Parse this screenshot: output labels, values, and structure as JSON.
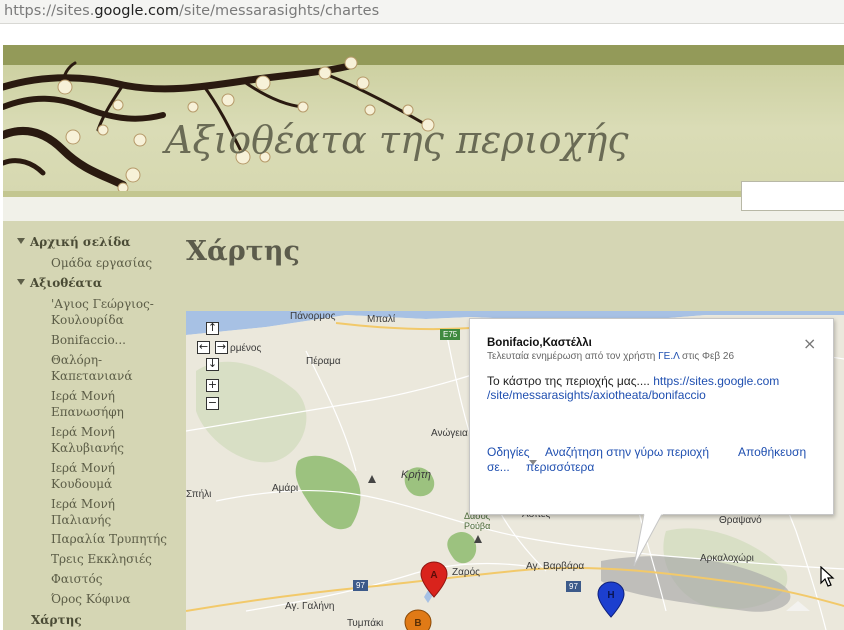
{
  "browser": {
    "url_prefix": "https://sites.",
    "url_domain": "google.com",
    "url_path": "/site/messarasights/chartes"
  },
  "site": {
    "title": "Αξιοθέατα της περιοχής"
  },
  "sidebar": {
    "home": "Αρχική σελίδα",
    "work_group": "Ομάδα εργασίας",
    "sights": "Αξιοθέατα",
    "items": [
      {
        "line1": "'Αγιος Γεώργιος-",
        "line2": "Κουλουρίδα"
      },
      {
        "line1": "Bonifaccio...",
        "line2": ""
      },
      {
        "line1": "Θαλόρη-",
        "line2": "Καπετανιανά"
      },
      {
        "line1": "Ιερά Μονή",
        "line2": "Επανωσήφη"
      },
      {
        "line1": "Ιερά Μονή",
        "line2": "Καλυβιανής"
      },
      {
        "line1": "Ιερά Μονή",
        "line2": "Κουδουμά"
      },
      {
        "line1": "Ιερά Μονή",
        "line2": "Παλιανής"
      },
      {
        "line1": "Παραλία Τρυπητής",
        "line2": ""
      },
      {
        "line1": "Τρεις Εκκλησιές",
        "line2": ""
      },
      {
        "line1": "Φαιστός",
        "line2": ""
      },
      {
        "line1": "Όρος Κόφινα",
        "line2": ""
      }
    ],
    "map": "Χάρτης"
  },
  "page": {
    "title": "Χάρτης"
  },
  "map": {
    "controls": {
      "up": "↑",
      "left": "←",
      "right": "→",
      "down": "↓",
      "zoom_in": "+",
      "zoom_out": "−"
    },
    "labels": {
      "panormos": "Πάνορμος",
      "mpali": "Μπαλί",
      "panormos_partial": "ρμένος",
      "perama": "Πέραμα",
      "anogia": "Ανώγεια",
      "kriti": "Κρήτη",
      "amari": "Αμάρι",
      "spili": "Σπήλι",
      "dasos_rouvas_1": "Δάσος",
      "dasos_rouvas_2": "Ρούβα",
      "asites": "Ασίτες",
      "thrapsano": "Θραψανό",
      "arkalochori": "Αρκαλοχώρι",
      "zaros": "Ζαρός",
      "ag_varvara": "Αγ. Βαρβάρα",
      "ag_galini": "Αγ. Γαλήνη",
      "tympaki": "Τυμπάκι"
    },
    "roads": {
      "e75": "E75",
      "r97a": "97",
      "r97b": "97"
    },
    "markers": {
      "a": "A",
      "b": "B",
      "h": "H"
    }
  },
  "popup": {
    "title": "Bonifacio,Καστέλλι",
    "close": "×",
    "updated_prefix": "Τελευταία ενημέρωση από τον χρήστη ",
    "updated_user": "ΓΕ.Λ",
    "updated_suffix": " στις Φεβ 26",
    "desc_text": "Το κάστρο της περιοχής μας.... ",
    "desc_link_1": "https://sites.google.com",
    "desc_link_2": "/site/messarasights/axiotheata/bonifaccio",
    "link_directions": "Οδηγίες",
    "link_search": "Αναζήτηση στην γύρω περιοχή",
    "link_save_1": "Αποθήκευση",
    "link_save_2": "σε...",
    "link_more": "περισσότερα"
  },
  "colors": {
    "header_band": "#939a59",
    "content_bg": "#d5d6b4",
    "link_blue": "#1f4fb0",
    "marker_red": "#d9231c",
    "marker_blue": "#1c3fcf",
    "marker_orange": "#e07a16"
  }
}
